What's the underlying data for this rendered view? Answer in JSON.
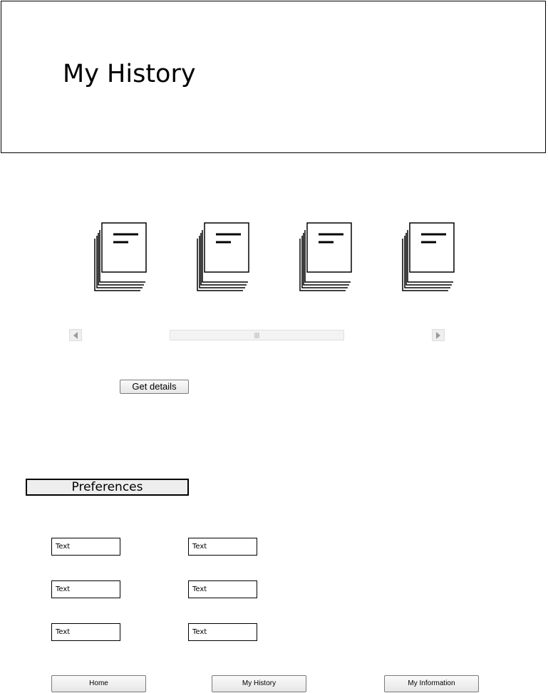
{
  "header": {
    "title": "My History"
  },
  "carousel": {
    "items": [
      {
        "icon": "document-stack-icon"
      },
      {
        "icon": "document-stack-icon"
      },
      {
        "icon": "document-stack-icon"
      },
      {
        "icon": "document-stack-icon"
      }
    ],
    "prev_icon": "triangle-left-icon",
    "next_icon": "triangle-right-icon"
  },
  "actions": {
    "get_details_label": "Get details"
  },
  "preferences": {
    "heading": "Preferences",
    "fields": [
      "Text",
      "Text",
      "Text",
      "Text",
      "Text",
      "Text"
    ]
  },
  "nav": {
    "home": "Home",
    "history": "My History",
    "information": "My Information"
  }
}
